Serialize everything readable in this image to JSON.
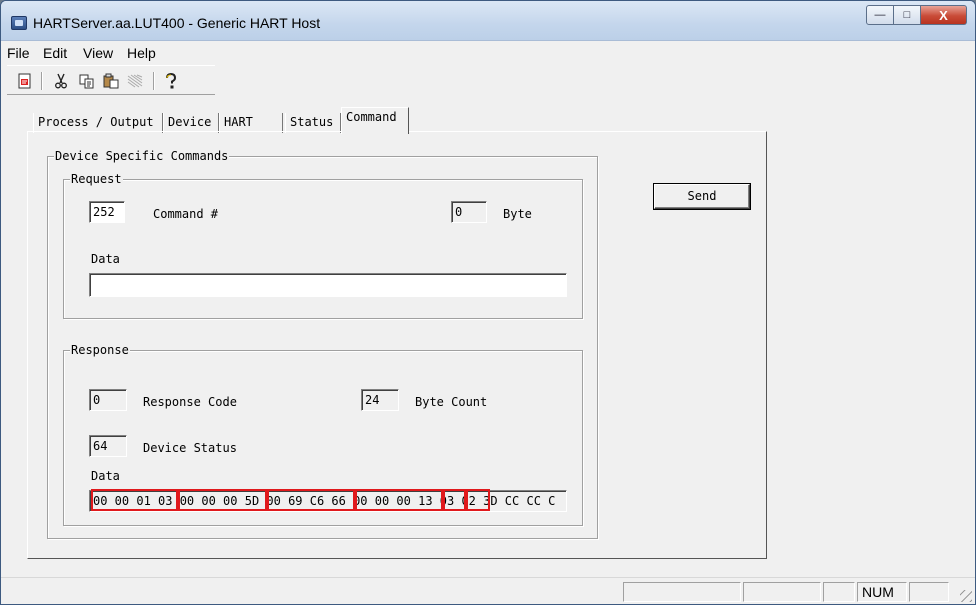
{
  "window": {
    "title": "HARTServer.aa.LUT400 - Generic HART Host",
    "caption": {
      "minimize": "—",
      "maximize": "□",
      "close": "X"
    }
  },
  "menu": [
    "File",
    "Edit",
    "View",
    "Help"
  ],
  "toolbar": {
    "icons": [
      "new-document-icon",
      "cut-icon",
      "copy-icon",
      "paste-icon",
      "print-disabled-icon",
      "help-icon"
    ]
  },
  "tabs": [
    {
      "label": "Process / Output",
      "active": false
    },
    {
      "label": "Device",
      "active": false
    },
    {
      "label": "HART",
      "active": false
    },
    {
      "label": "Status",
      "active": false
    },
    {
      "label": "Command",
      "active": true
    }
  ],
  "command_panel": {
    "group_title": "Device Specific Commands",
    "request": {
      "title": "Request",
      "command_value": "252",
      "command_label": "Command #",
      "byte_value": "0",
      "byte_label": "Byte",
      "data_label": "Data",
      "data_value": ""
    },
    "send_label": "Send",
    "response": {
      "title": "Response",
      "response_code_value": "0",
      "response_code_label": "Response Code",
      "byte_count_value": "24",
      "byte_count_label": "Byte Count",
      "device_status_value": "64",
      "device_status_label": "Device Status",
      "data_label": "Data",
      "data_value": "00 00 01 03 00 00 00 5D 00 69 C6 66 00 00 00 13 03 02 3D CC CC C"
    }
  },
  "highlight_color": "#e0191c",
  "statusbar": {
    "num": "NUM"
  }
}
